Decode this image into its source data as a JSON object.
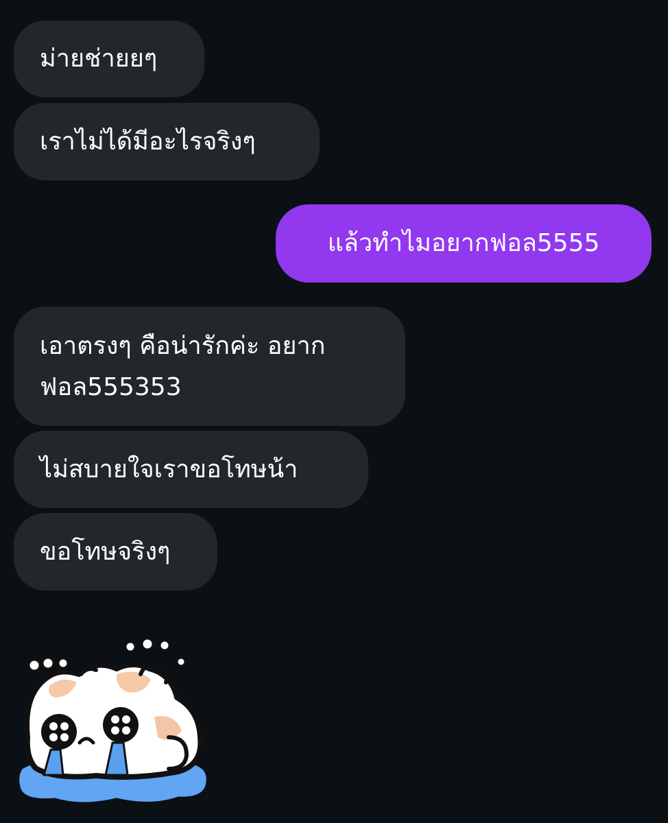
{
  "messages": [
    {
      "direction": "received",
      "text": "ม่ายช่ายยๆ"
    },
    {
      "direction": "received",
      "text": "เราไม่ได้มีอะไรจริงๆ"
    },
    {
      "direction": "sent",
      "text": "แล้วทำไมอยากฟอล5555"
    },
    {
      "direction": "received",
      "text": "เอาตรงๆ คือน่ารักค่ะ อยากฟอล555353"
    },
    {
      "direction": "received",
      "text": "ไม่สบายใจเราขอโทษน้า"
    },
    {
      "direction": "received",
      "text": "ขอโทษจริงๆ"
    }
  ],
  "sticker": {
    "icon": "crying-cat-sticker-icon"
  },
  "colors": {
    "background": "#0b1014",
    "received_bubble": "#23272c",
    "sent_bubble": "#9238ef",
    "text": "#ffffff"
  }
}
